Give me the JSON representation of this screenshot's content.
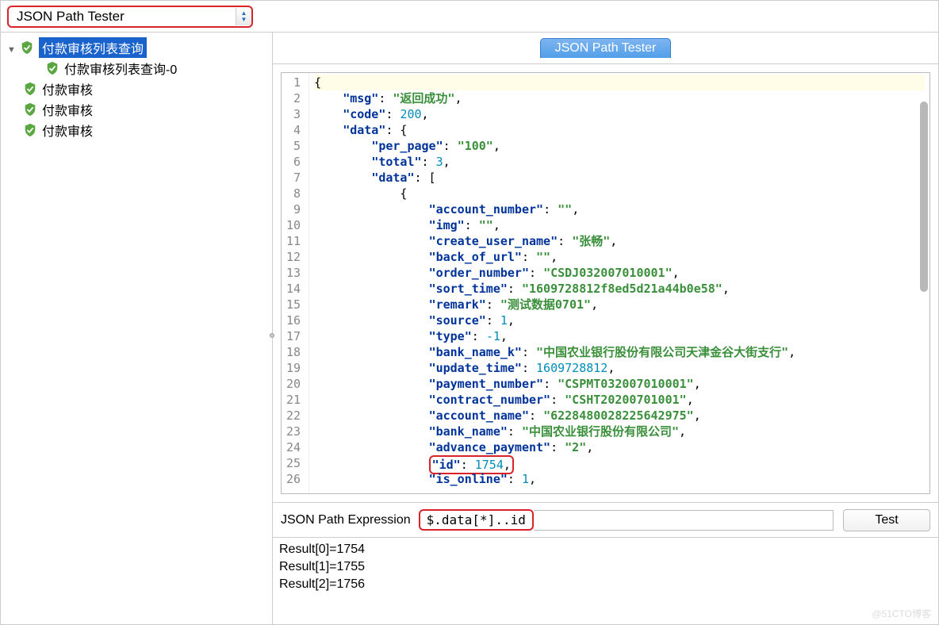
{
  "toolbar": {
    "dropdown_label": "JSON Path Tester"
  },
  "tab": {
    "title": "JSON Path Tester"
  },
  "tree": {
    "root": "付款审核列表查询",
    "child": "付款审核列表查询-0",
    "item2": "付款审核",
    "item3": "付款审核",
    "item4": "付款审核"
  },
  "code": {
    "lines": [
      "{",
      "    \"msg\": \"返回成功\",",
      "    \"code\": 200,",
      "    \"data\": {",
      "        \"per_page\": \"100\",",
      "        \"total\": 3,",
      "        \"data\": [",
      "            {",
      "                \"account_number\": \"\",",
      "                \"img\": \"\",",
      "                \"create_user_name\": \"张畅\",",
      "                \"back_of_url\": \"\",",
      "                \"order_number\": \"CSDJ032007010001\",",
      "                \"sort_time\": \"1609728812f8ed5d21a44b0e58\",",
      "                \"remark\": \"测试数据0701\",",
      "                \"source\": 1,",
      "                \"type\": -1,",
      "                \"bank_name_k\": \"中国农业银行股份有限公司天津金谷大街支行\",",
      "                \"update_time\": 1609728812,",
      "                \"payment_number\": \"CSPMT032007010001\",",
      "                \"contract_number\": \"CSHT20200701001\",",
      "                \"account_name\": \"6228480028225642975\",",
      "                \"bank_name\": \"中国农业银行股份有限公司\",",
      "                \"advance_payment\": \"2\",",
      "                \"id\": 1754,",
      "                \"is_online\": 1,"
    ]
  },
  "expr": {
    "label": "JSON Path Expression",
    "value": "$.data[*]..id",
    "test_btn": "Test"
  },
  "results": {
    "r0": "Result[0]=1754",
    "r1": "Result[1]=1755",
    "r2": "Result[2]=1756"
  },
  "watermark": "@51CTO博客"
}
